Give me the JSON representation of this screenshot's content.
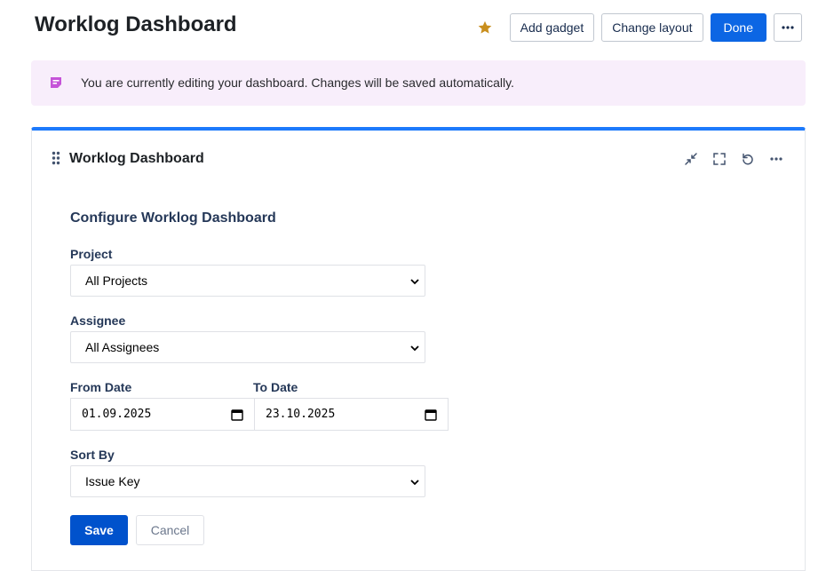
{
  "header": {
    "title": "Worklog Dashboard",
    "add_gadget_label": "Add gadget",
    "change_layout_label": "Change layout",
    "done_label": "Done",
    "star_icon": "star-icon",
    "more_icon": "more-horizontal-icon"
  },
  "banner": {
    "icon": "edit-note-icon",
    "text": "You are currently editing your dashboard. Changes will be saved automatically."
  },
  "gadget": {
    "title": "Worklog Dashboard",
    "actions": [
      "minimize-icon",
      "fullscreen-icon",
      "refresh-icon",
      "more-horizontal-icon"
    ],
    "config": {
      "heading": "Configure Worklog Dashboard",
      "project": {
        "label": "Project",
        "value": "All Projects"
      },
      "assignee": {
        "label": "Assignee",
        "value": "All Assignees"
      },
      "from_date": {
        "label": "From Date",
        "value": "01.09.2025"
      },
      "to_date": {
        "label": "To Date",
        "value": "23.10.2025"
      },
      "sort_by": {
        "label": "Sort By",
        "value": "Issue Key"
      },
      "save_label": "Save",
      "cancel_label": "Cancel"
    }
  },
  "colors": {
    "accent": "#0c66e4",
    "gadget_top_border": "#1d7afc",
    "banner_bg": "#f8eefb",
    "star": "#c98f1e",
    "banner_icon": "#c553d8"
  }
}
